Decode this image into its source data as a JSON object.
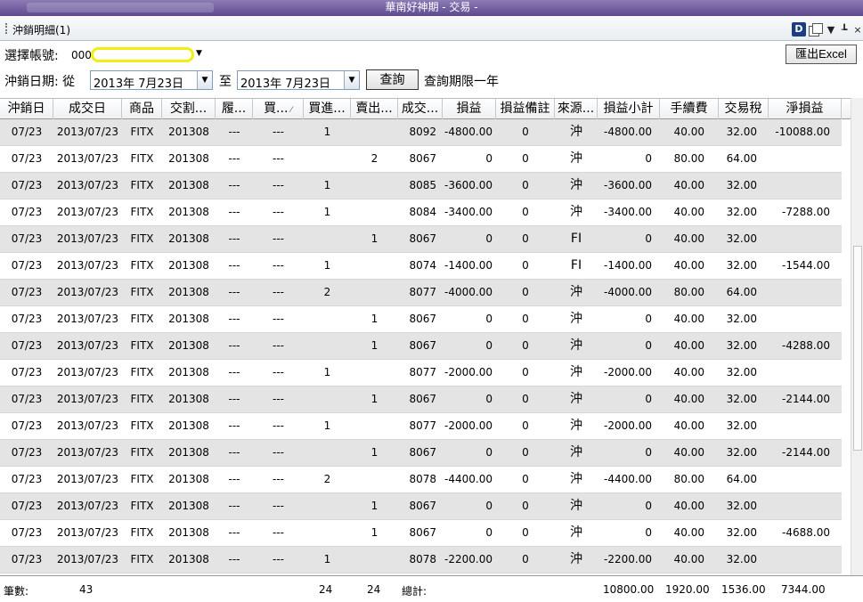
{
  "window": {
    "title": "華南好神期 - 交易 -"
  },
  "panel": {
    "title": "沖銷明細(1)",
    "tool_close": "×"
  },
  "toolbar": {
    "account_label": "選擇帳號:",
    "account_prefix": "000",
    "date_label": "沖銷日期: 從",
    "date_from": "2013年  7月23日",
    "to_label": "至",
    "date_to": "2013年  7月23日",
    "query_label": "查詢",
    "limit_note": "查詢期限一年",
    "excel_label": "匯出Excel"
  },
  "columns": [
    {
      "label": "沖銷日",
      "sort": false
    },
    {
      "label": "成交日",
      "sort": false
    },
    {
      "label": "商品",
      "sort": false
    },
    {
      "label": "交割...",
      "sort": false
    },
    {
      "label": "履...",
      "sort": false
    },
    {
      "label": "買...",
      "sort": true
    },
    {
      "label": "買進...",
      "sort": false
    },
    {
      "label": "賣出...",
      "sort": false
    },
    {
      "label": "成交...",
      "sort": false
    },
    {
      "label": "損益",
      "sort": false
    },
    {
      "label": "損益備註",
      "sort": false
    },
    {
      "label": "來源...",
      "sort": false
    },
    {
      "label": "損益小計",
      "sort": false
    },
    {
      "label": "手續費",
      "sort": false
    },
    {
      "label": "交易稅",
      "sort": false
    },
    {
      "label": "淨損益",
      "sort": false
    }
  ],
  "rows": [
    [
      "07/23",
      "2013/07/23",
      "FITX",
      "201308",
      "---",
      "---",
      "1",
      "",
      "8092",
      "-4800.00",
      "0",
      "沖",
      "-4800.00",
      "40.00",
      "32.00",
      "-10088.00"
    ],
    [
      "07/23",
      "2013/07/23",
      "FITX",
      "201308",
      "---",
      "---",
      "",
      "2",
      "8067",
      "0",
      "0",
      "沖",
      "0",
      "80.00",
      "64.00",
      ""
    ],
    [
      "07/23",
      "2013/07/23",
      "FITX",
      "201308",
      "---",
      "---",
      "1",
      "",
      "8085",
      "-3600.00",
      "0",
      "沖",
      "-3600.00",
      "40.00",
      "32.00",
      ""
    ],
    [
      "07/23",
      "2013/07/23",
      "FITX",
      "201308",
      "---",
      "---",
      "1",
      "",
      "8084",
      "-3400.00",
      "0",
      "沖",
      "-3400.00",
      "40.00",
      "32.00",
      "-7288.00"
    ],
    [
      "07/23",
      "2013/07/23",
      "FITX",
      "201308",
      "---",
      "---",
      "",
      "1",
      "8067",
      "0",
      "0",
      "FI",
      "0",
      "40.00",
      "32.00",
      ""
    ],
    [
      "07/23",
      "2013/07/23",
      "FITX",
      "201308",
      "---",
      "---",
      "1",
      "",
      "8074",
      "-1400.00",
      "0",
      "FI",
      "-1400.00",
      "40.00",
      "32.00",
      "-1544.00"
    ],
    [
      "07/23",
      "2013/07/23",
      "FITX",
      "201308",
      "---",
      "---",
      "2",
      "",
      "8077",
      "-4000.00",
      "0",
      "沖",
      "-4000.00",
      "80.00",
      "64.00",
      ""
    ],
    [
      "07/23",
      "2013/07/23",
      "FITX",
      "201308",
      "---",
      "---",
      "",
      "1",
      "8067",
      "0",
      "0",
      "沖",
      "0",
      "40.00",
      "32.00",
      ""
    ],
    [
      "07/23",
      "2013/07/23",
      "FITX",
      "201308",
      "---",
      "---",
      "",
      "1",
      "8067",
      "0",
      "0",
      "沖",
      "0",
      "40.00",
      "32.00",
      "-4288.00"
    ],
    [
      "07/23",
      "2013/07/23",
      "FITX",
      "201308",
      "---",
      "---",
      "1",
      "",
      "8077",
      "-2000.00",
      "0",
      "沖",
      "-2000.00",
      "40.00",
      "32.00",
      ""
    ],
    [
      "07/23",
      "2013/07/23",
      "FITX",
      "201308",
      "---",
      "---",
      "",
      "1",
      "8067",
      "0",
      "0",
      "沖",
      "0",
      "40.00",
      "32.00",
      "-2144.00"
    ],
    [
      "07/23",
      "2013/07/23",
      "FITX",
      "201308",
      "---",
      "---",
      "1",
      "",
      "8077",
      "-2000.00",
      "0",
      "沖",
      "-2000.00",
      "40.00",
      "32.00",
      ""
    ],
    [
      "07/23",
      "2013/07/23",
      "FITX",
      "201308",
      "---",
      "---",
      "",
      "1",
      "8067",
      "0",
      "0",
      "沖",
      "0",
      "40.00",
      "32.00",
      "-2144.00"
    ],
    [
      "07/23",
      "2013/07/23",
      "FITX",
      "201308",
      "---",
      "---",
      "2",
      "",
      "8078",
      "-4400.00",
      "0",
      "沖",
      "-4400.00",
      "80.00",
      "64.00",
      ""
    ],
    [
      "07/23",
      "2013/07/23",
      "FITX",
      "201308",
      "---",
      "---",
      "",
      "1",
      "8067",
      "0",
      "0",
      "沖",
      "0",
      "40.00",
      "32.00",
      ""
    ],
    [
      "07/23",
      "2013/07/23",
      "FITX",
      "201308",
      "---",
      "---",
      "",
      "1",
      "8067",
      "0",
      "0",
      "沖",
      "0",
      "40.00",
      "32.00",
      "-4688.00"
    ],
    [
      "07/23",
      "2013/07/23",
      "FITX",
      "201308",
      "---",
      "---",
      "1",
      "",
      "8078",
      "-2200.00",
      "0",
      "沖",
      "-2200.00",
      "40.00",
      "32.00",
      ""
    ]
  ],
  "footer": {
    "count_label": "筆數:",
    "count_value": "43",
    "buy_total": "24",
    "sell_total": "24",
    "total_label": "總計:",
    "pnl_subtotal": "10800.00",
    "fee_total": "1920.00",
    "tax_total": "1536.00",
    "net_total": "7344.00"
  },
  "colors": {
    "alt_row": "#e4e4e4",
    "title_bar": "#6b5a9c",
    "highlight": "#f5ec14"
  }
}
